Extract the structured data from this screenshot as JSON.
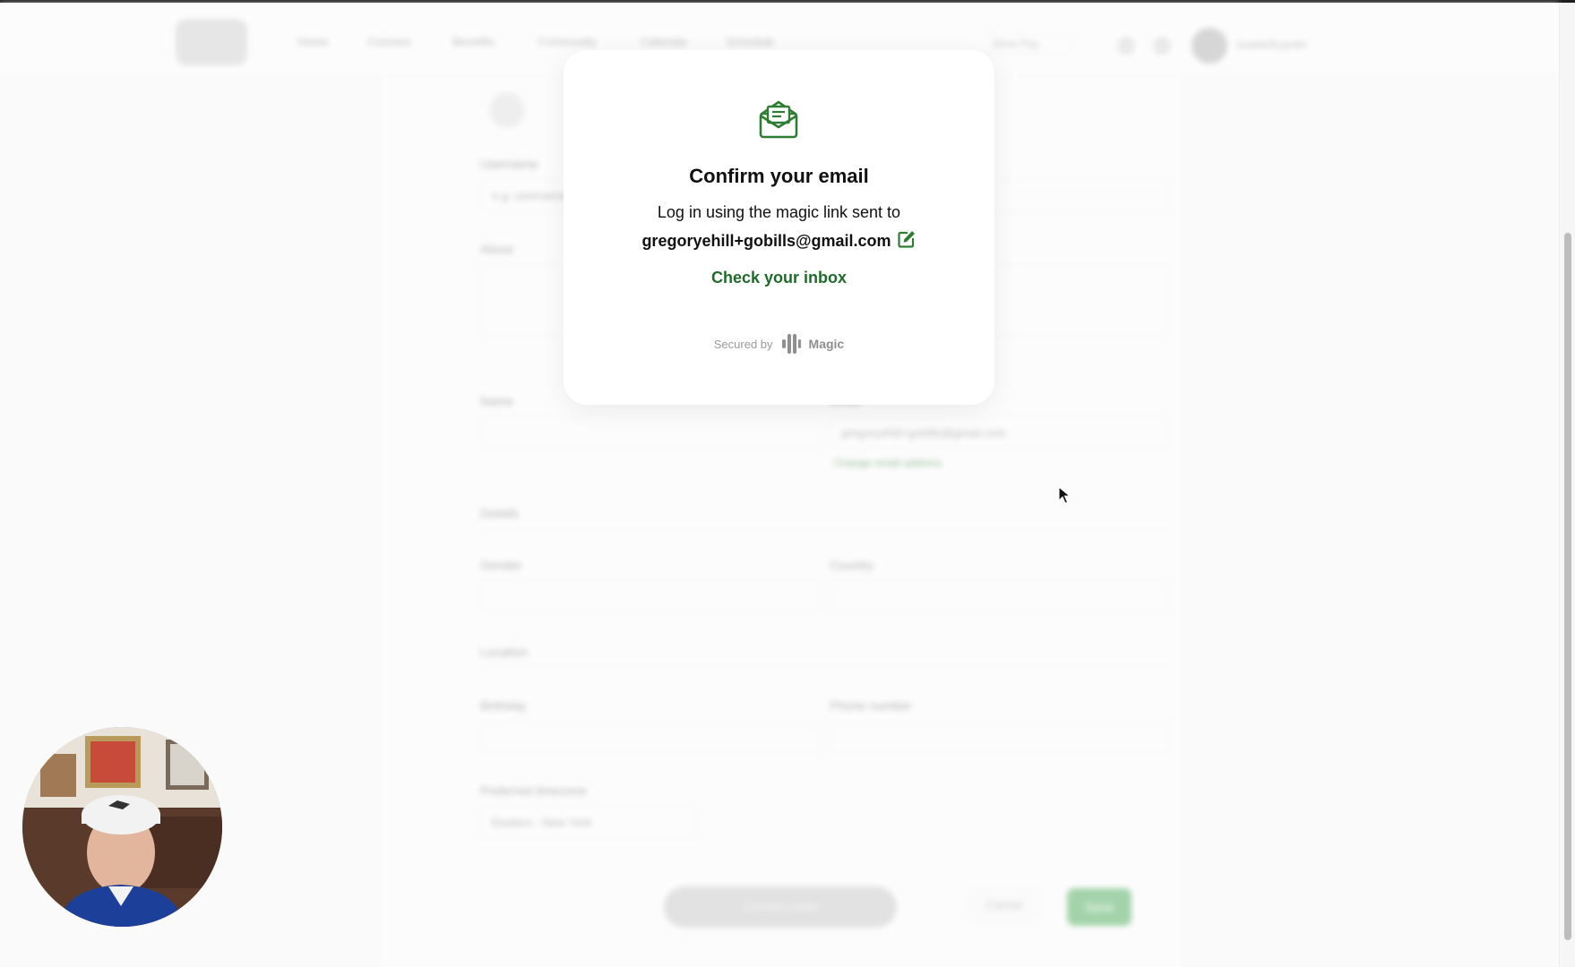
{
  "background_page": {
    "nav": [
      "Home",
      "Courses",
      "Benefits",
      "Community",
      "Calendar",
      "Schedule"
    ],
    "select_value": "Store Pay",
    "user_name": "GobillsRyan84",
    "labels": {
      "username": "Username",
      "about": "About",
      "name": "Name",
      "email": "Email",
      "details": "Details",
      "gender": "Gender",
      "country": "Country",
      "location": "Location",
      "birthday": "Birthday",
      "phone_number": "Phone number",
      "preferred_timezone": "Preferred timezone"
    },
    "username_placeholder": "e.g. username",
    "email_value": "gregoryehill+gobills@gmail.com",
    "change_email_link": "Change email address",
    "timezone_value": "Eastern - New York",
    "connect_button": "Connect wallet",
    "cancel_button": "Cancel",
    "save_button": "Save"
  },
  "modal": {
    "title": "Confirm your email",
    "subtitle": "Log in using the magic link sent to",
    "email": "gregoryehill+gobills@gmail.com",
    "check_inbox": "Check your inbox",
    "secured_by": "Secured by",
    "brand": "Magic"
  },
  "colors": {
    "accent_green": "#1e6b2a",
    "icon_green": "#2e7d32",
    "save_green": "#5eb56a"
  },
  "icons": {
    "envelope": "envelope-open-icon",
    "edit": "edit-icon",
    "magic": "magic-logo-icon"
  }
}
